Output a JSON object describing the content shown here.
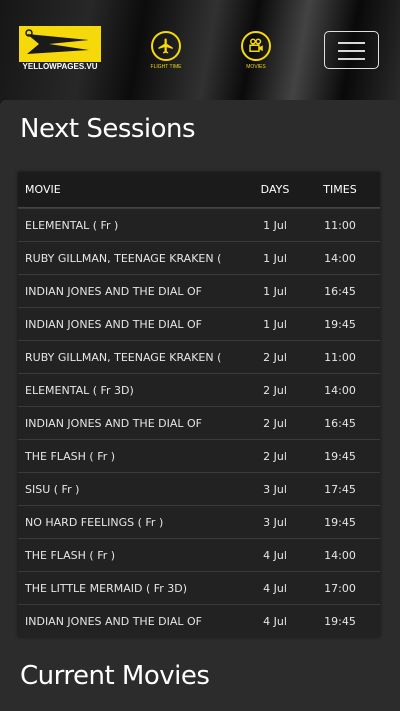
{
  "header": {
    "logo_text": "YELLOWPAGES.VU",
    "nav": [
      {
        "label": "FLIGHT TIME",
        "icon": "airplane-icon"
      },
      {
        "label": "MOVIES",
        "icon": "film-camera-icon"
      }
    ],
    "menu_icon": "hamburger-menu-icon",
    "accent": "#f5d90a"
  },
  "sessions": {
    "title": "Next Sessions",
    "columns": [
      "MOVIE",
      "DAYS",
      "TIMES"
    ],
    "rows": [
      {
        "movie": "ELEMENTAL ( Fr )",
        "day": "1 Jul",
        "time": "11:00"
      },
      {
        "movie": "RUBY GILLMAN, TEENAGE KRAKEN (",
        "day": "1 Jul",
        "time": "14:00"
      },
      {
        "movie": "INDIAN JONES AND THE DIAL OF",
        "day": "1 Jul",
        "time": "16:45"
      },
      {
        "movie": "INDIAN JONES AND THE DIAL OF",
        "day": "1 Jul",
        "time": "19:45"
      },
      {
        "movie": "RUBY GILLMAN, TEENAGE KRAKEN (",
        "day": "2 Jul",
        "time": "11:00"
      },
      {
        "movie": "ELEMENTAL ( Fr 3D)",
        "day": "2 Jul",
        "time": "14:00"
      },
      {
        "movie": "INDIAN JONES AND THE DIAL OF",
        "day": "2 Jul",
        "time": "16:45"
      },
      {
        "movie": "THE FLASH ( Fr )",
        "day": "2 Jul",
        "time": "19:45"
      },
      {
        "movie": "SISU ( Fr )",
        "day": "3 Jul",
        "time": "17:45"
      },
      {
        "movie": "NO HARD FEELINGS ( Fr )",
        "day": "3 Jul",
        "time": "19:45"
      },
      {
        "movie": "THE FLASH ( Fr )",
        "day": "4 Jul",
        "time": "14:00"
      },
      {
        "movie": "THE LITTLE MERMAID ( Fr 3D)",
        "day": "4 Jul",
        "time": "17:00"
      },
      {
        "movie": "INDIAN JONES AND THE DIAL OF",
        "day": "4 Jul",
        "time": "19:45"
      }
    ]
  },
  "current": {
    "title": "Current Movies"
  }
}
